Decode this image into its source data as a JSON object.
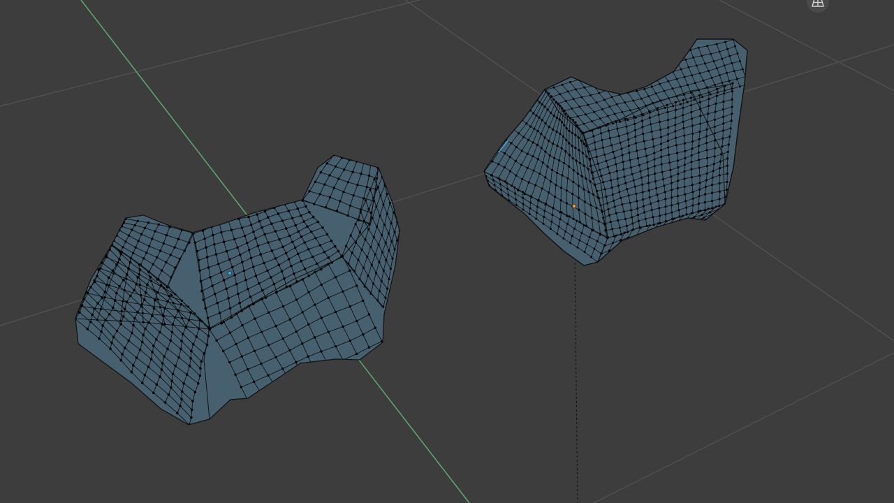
{
  "app": {
    "editor": "3d-viewport",
    "mode": "edit-mode-vertex-select"
  },
  "viewport": {
    "background_color": "#3d3d3d",
    "grid_color": "#545454",
    "y_axis_color": "#5aa56b",
    "mesh_face_color": "#46606f",
    "mesh_edge_color": "#111111",
    "mesh_vertex_color": "#000000",
    "active_origin_color": "#e59d45",
    "selected_origin_color": "#3ea6e0",
    "icons": {
      "view_toggle": "grid-perspective-icon"
    }
  },
  "objects": [
    {
      "name_icon": "mesh-object-left",
      "origin": "selected-origin-marker"
    },
    {
      "name_icon": "mesh-object-right",
      "origin": "active-origin-marker"
    }
  ]
}
